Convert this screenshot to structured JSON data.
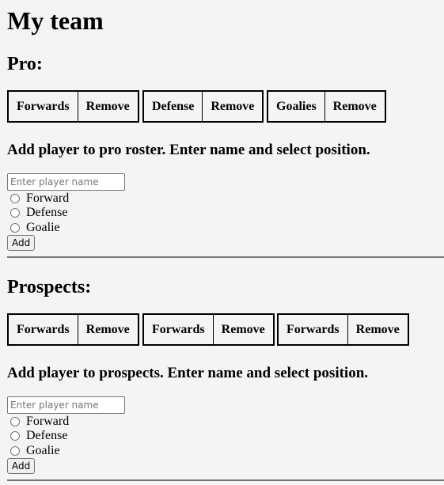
{
  "page": {
    "title": "My team"
  },
  "pro": {
    "title": "Pro:",
    "positions": [
      {
        "label": "Forwards",
        "remove": "Remove"
      },
      {
        "label": "Defense",
        "remove": "Remove"
      },
      {
        "label": "Goalies",
        "remove": "Remove"
      }
    ],
    "instructions": "Add player to pro roster. Enter name and select position.",
    "input_placeholder": "Enter player name",
    "radio_options": [
      "Forward",
      "Defense",
      "Goalie"
    ],
    "add_label": "Add"
  },
  "prospects": {
    "title": "Prospects:",
    "positions": [
      {
        "label": "Forwards",
        "remove": "Remove"
      },
      {
        "label": "Forwards",
        "remove": "Remove"
      },
      {
        "label": "Forwards",
        "remove": "Remove"
      }
    ],
    "instructions": "Add player to prospects. Enter name and select position.",
    "input_placeholder": "Enter player name",
    "radio_options": [
      "Forward",
      "Defense",
      "Goalie"
    ],
    "add_label": "Add"
  }
}
